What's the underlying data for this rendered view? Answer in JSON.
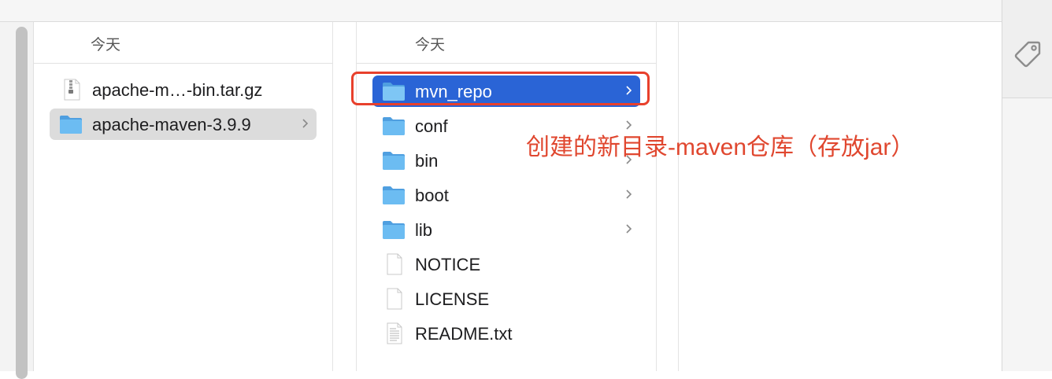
{
  "columns": {
    "downloads": {
      "header": "今天",
      "items": [
        {
          "label": "apache-m…-bin.tar.gz",
          "icon": "archive-file-icon",
          "chevron": false,
          "selected": false
        },
        {
          "label": "apache-maven-3.9.9",
          "icon": "folder-icon",
          "chevron": true,
          "selected": true
        }
      ]
    },
    "maven": {
      "header": "今天",
      "items": [
        {
          "label": "mvn_repo",
          "icon": "folder-icon",
          "chevron": true,
          "selected": true
        },
        {
          "label": "conf",
          "icon": "folder-icon",
          "chevron": true,
          "selected": false
        },
        {
          "label": "bin",
          "icon": "folder-icon",
          "chevron": true,
          "selected": false
        },
        {
          "label": "boot",
          "icon": "folder-icon",
          "chevron": true,
          "selected": false
        },
        {
          "label": "lib",
          "icon": "folder-icon",
          "chevron": true,
          "selected": false
        },
        {
          "label": "NOTICE",
          "icon": "document-icon",
          "chevron": false,
          "selected": false
        },
        {
          "label": "LICENSE",
          "icon": "document-icon",
          "chevron": false,
          "selected": false
        },
        {
          "label": "README.txt",
          "icon": "text-document-icon",
          "chevron": false,
          "selected": false
        }
      ]
    }
  },
  "annotation": {
    "text": "创建的新目录-maven仓库（存放jar）",
    "color": "#e0472f"
  },
  "side_panel": {
    "icon": "tag-icon"
  },
  "colors": {
    "selection_blue": "#2a64d6",
    "folder_blue": "#5ab0ee",
    "selection_grey": "#dcdcdc"
  }
}
